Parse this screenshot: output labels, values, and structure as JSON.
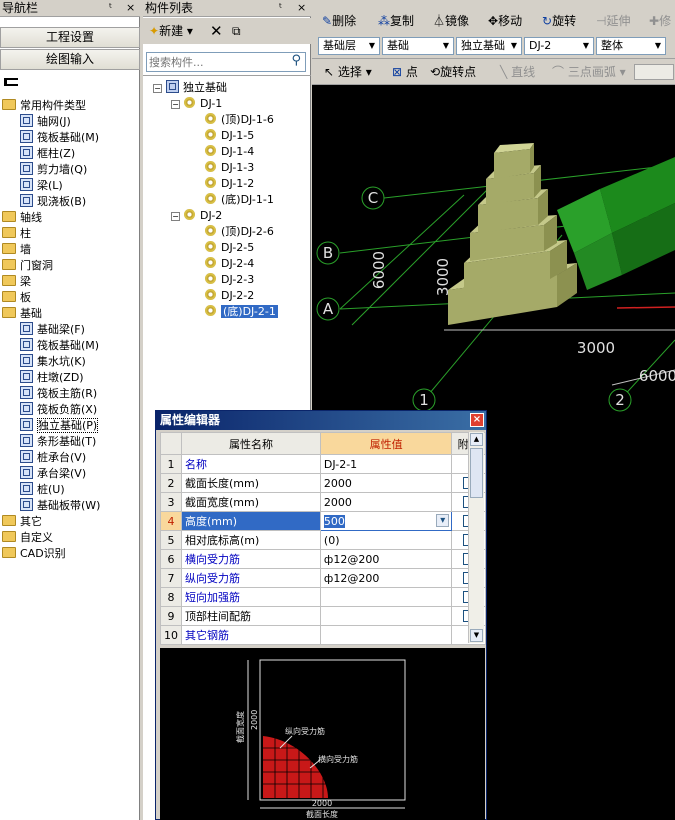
{
  "nav": {
    "title": "导航栏",
    "pin": "ᵗ",
    "close": "×",
    "btn_project": "工程设置",
    "btn_draw": "绘图输入",
    "tree": [
      {
        "label": "常用构件类型",
        "kind": "folder",
        "indent": 0,
        "expanded": true
      },
      {
        "label": "轴网(J)",
        "kind": "item",
        "indent": 1
      },
      {
        "label": "筏板基础(M)",
        "kind": "item",
        "indent": 1
      },
      {
        "label": "框柱(Z)",
        "kind": "item",
        "indent": 1
      },
      {
        "label": "剪力墙(Q)",
        "kind": "item",
        "indent": 1
      },
      {
        "label": "梁(L)",
        "kind": "item",
        "indent": 1
      },
      {
        "label": "现浇板(B)",
        "kind": "item",
        "indent": 1
      },
      {
        "label": "轴线",
        "kind": "folder",
        "indent": 0
      },
      {
        "label": "柱",
        "kind": "folder",
        "indent": 0
      },
      {
        "label": "墙",
        "kind": "folder",
        "indent": 0
      },
      {
        "label": "门窗洞",
        "kind": "folder",
        "indent": 0
      },
      {
        "label": "梁",
        "kind": "folder",
        "indent": 0
      },
      {
        "label": "板",
        "kind": "folder",
        "indent": 0
      },
      {
        "label": "基础",
        "kind": "folder",
        "indent": 0,
        "expanded": true
      },
      {
        "label": "基础梁(F)",
        "kind": "item",
        "indent": 1
      },
      {
        "label": "筏板基础(M)",
        "kind": "item",
        "indent": 1
      },
      {
        "label": "集水坑(K)",
        "kind": "item",
        "indent": 1
      },
      {
        "label": "柱墩(ZD)",
        "kind": "item",
        "indent": 1
      },
      {
        "label": "筏板主筋(R)",
        "kind": "item",
        "indent": 1
      },
      {
        "label": "筏板负筋(X)",
        "kind": "item",
        "indent": 1
      },
      {
        "label": "独立基础(P)",
        "kind": "item",
        "indent": 1,
        "selected": true
      },
      {
        "label": "条形基础(T)",
        "kind": "item",
        "indent": 1
      },
      {
        "label": "桩承台(V)",
        "kind": "item",
        "indent": 1
      },
      {
        "label": "承台梁(V)",
        "kind": "item",
        "indent": 1
      },
      {
        "label": "桩(U)",
        "kind": "item",
        "indent": 1
      },
      {
        "label": "基础板带(W)",
        "kind": "item",
        "indent": 1
      },
      {
        "label": "其它",
        "kind": "folder",
        "indent": 0
      },
      {
        "label": "自定义",
        "kind": "folder",
        "indent": 0
      },
      {
        "label": "CAD识别",
        "kind": "folder",
        "indent": 0
      }
    ]
  },
  "complist": {
    "title": "构件列表",
    "new_label": "新建",
    "search_placeholder": "搜索构件...",
    "root": "独立基础",
    "groups": [
      {
        "name": "DJ-1",
        "items": [
          "(顶)DJ-1-6",
          "DJ-1-5",
          "DJ-1-4",
          "DJ-1-3",
          "DJ-1-2",
          "(底)DJ-1-1"
        ]
      },
      {
        "name": "DJ-2",
        "items": [
          "(顶)DJ-2-6",
          "DJ-2-5",
          "DJ-2-4",
          "DJ-2-3",
          "DJ-2-2",
          "(底)DJ-2-1"
        ]
      }
    ],
    "selected": "(底)DJ-2-1"
  },
  "toolbar1": {
    "delete": "删除",
    "copy": "复制",
    "mirror": "镜像",
    "move": "移动",
    "rotate": "旋转",
    "extend": "延伸",
    "trim": "修"
  },
  "toolbar2": {
    "layer": "基础层",
    "category": "基础",
    "type": "独立基础",
    "name": "DJ-2",
    "scope": "整体"
  },
  "toolbar3": {
    "select": "选择",
    "point": "点",
    "rotate_point": "旋转点",
    "line": "直线",
    "arc": "三点画弧"
  },
  "view": {
    "axis_c": "C",
    "axis_b": "B",
    "axis_a": "A",
    "axis_1": "1",
    "axis_2": "2",
    "dim_6000_v": "6000",
    "dim_3000_v": "3000",
    "dim_3000_h": "3000",
    "dim_6000_h": "6000"
  },
  "dialog": {
    "title": "属性编辑器",
    "close": "×",
    "col_name": "属性名称",
    "col_value": "属性值",
    "col_add": "附加",
    "rows": [
      {
        "n": "1",
        "name": "名称",
        "value": "DJ-2-1",
        "blue": true,
        "check": false
      },
      {
        "n": "2",
        "name": "截面长度(mm)",
        "value": "2000",
        "check": true
      },
      {
        "n": "3",
        "name": "截面宽度(mm)",
        "value": "2000",
        "check": true
      },
      {
        "n": "4",
        "name": "高度(mm)",
        "value": "500",
        "check": true,
        "editing": true
      },
      {
        "n": "5",
        "name": "相对底标高(m)",
        "value": "(0)",
        "check": true
      },
      {
        "n": "6",
        "name": "横向受力筋",
        "value": "ф12@200",
        "blue": true,
        "check": true
      },
      {
        "n": "7",
        "name": "纵向受力筋",
        "value": "ф12@200",
        "blue": true,
        "check": true
      },
      {
        "n": "8",
        "name": "短向加强筋",
        "value": "",
        "blue": true,
        "check": true
      },
      {
        "n": "9",
        "name": "顶部柱间配筋",
        "value": "",
        "check": true
      },
      {
        "n": "10",
        "name": "其它钢筋",
        "value": "",
        "blue": true,
        "check": false
      }
    ],
    "preview": {
      "label_width": "截面宽度",
      "label_2000_v": "2000",
      "label_long": "纵向受力筋",
      "label_trans": "横向受力筋",
      "label_2000_h": "2000",
      "label_len": "截面长度"
    }
  }
}
